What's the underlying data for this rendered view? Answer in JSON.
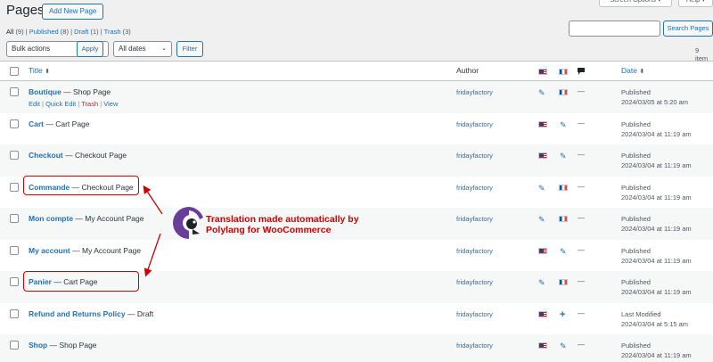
{
  "header": {
    "title": "Pages",
    "add_new": "Add New Page",
    "screen_options": "Screen Options ▾",
    "help": "Help ▾"
  },
  "filters": {
    "all": "All",
    "all_count": "(9)",
    "published": "Published",
    "published_count": "(8)",
    "draft": "Draft",
    "draft_count": "(1)",
    "trash": "Trash",
    "trash_count": "(3)",
    "sep": "|"
  },
  "search": {
    "placeholder": "",
    "button": "Search Pages"
  },
  "toolbar": {
    "bulk_actions": "Bulk actions",
    "apply": "Apply",
    "all_dates": "All dates",
    "filter": "Filter",
    "items_count": "9 item"
  },
  "columns": {
    "title": "Title",
    "author": "Author",
    "date": "Date"
  },
  "rows": [
    {
      "title": "Boutique",
      "suffix": " — Shop Page",
      "author": "fridayfactory",
      "status": "Published",
      "date": "2024/03/05 at 5:20 am",
      "actions": {
        "edit": "Edit",
        "quick_edit": "Quick Edit",
        "trash": "Trash",
        "view": "View",
        "sep": " | "
      }
    },
    {
      "title": "Cart",
      "suffix": " — Cart Page",
      "author": "fridayfactory",
      "status": "Published",
      "date": "2024/03/04 at 11:19 am"
    },
    {
      "title": "Checkout",
      "suffix": " — Checkout Page",
      "author": "fridayfactory",
      "status": "Published",
      "date": "2024/03/04 at 11:19 am"
    },
    {
      "title": "Commande",
      "suffix": " — Checkout Page",
      "author": "fridayfactory",
      "status": "Published",
      "date": "2024/03/04 at 11:19 am"
    },
    {
      "title": "Mon compte",
      "suffix": " — My Account Page",
      "author": "fridayfactory",
      "status": "Published",
      "date": "2024/03/04 at 11:19 am"
    },
    {
      "title": "My account",
      "suffix": " — My Account Page",
      "author": "fridayfactory",
      "status": "Published",
      "date": "2024/03/04 at 11:19 am"
    },
    {
      "title": "Panier",
      "suffix": " — Cart Page",
      "author": "fridayfactory",
      "status": "Published",
      "date": "2024/03/04 at 11:19 am"
    },
    {
      "title": "Refund and Returns Policy",
      "suffix": " — Draft",
      "author": "fridayfactory",
      "status": "Last Modified",
      "date": "2024/03/04 at 5:15 am"
    },
    {
      "title": "Shop",
      "suffix": " — Shop Page",
      "author": "fridayfactory",
      "status": "Published",
      "date": "2024/03/04 at 11:19 am"
    }
  ],
  "icons": {
    "pencil": "✎",
    "plus": "+",
    "dash": "—",
    "sort": "⬍"
  },
  "annotation": {
    "line1": "Translation made automatically by",
    "line2": "Polylang for WooCommerce"
  },
  "colors": {
    "accent": "#2271b1",
    "annotation": "#d00000",
    "polylang": "#6a3d9a"
  }
}
